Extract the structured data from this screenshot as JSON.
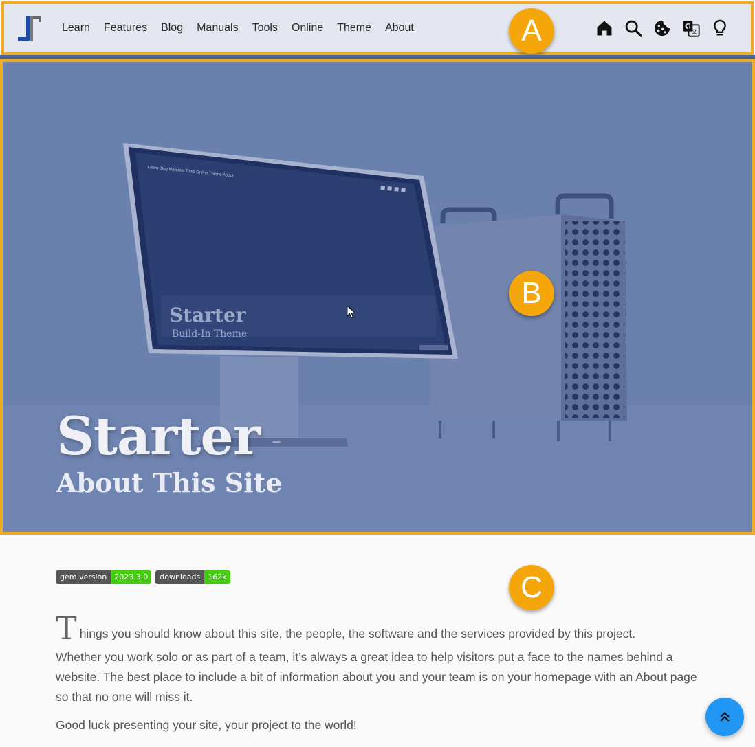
{
  "nav": {
    "items": [
      {
        "label": "Learn"
      },
      {
        "label": "Features"
      },
      {
        "label": "Blog"
      },
      {
        "label": "Manuals"
      },
      {
        "label": "Tools"
      },
      {
        "label": "Online"
      },
      {
        "label": "Theme"
      },
      {
        "label": "About"
      }
    ],
    "icons": [
      "home-icon",
      "search-icon",
      "cookie-icon",
      "translate-icon",
      "lightbulb-icon"
    ]
  },
  "hero": {
    "title": "Starter",
    "subtitle": "About This Site",
    "screen_title": "Starter",
    "screen_subtitle": "Build-In Theme",
    "screen_nav": [
      "Learn",
      "Blog",
      "Manuals",
      "Tools",
      "Online",
      "Theme",
      "About"
    ]
  },
  "markers": {
    "a": "A",
    "b": "B",
    "c": "C"
  },
  "badges": [
    {
      "label": "gem version",
      "value": "2023.3.0"
    },
    {
      "label": "downloads",
      "value": "162k"
    }
  ],
  "content": {
    "dropcap": "T",
    "intro": "hings you should know about this site, the people, the software and the services provided by this project.",
    "paragraph2": "Whether you work solo or as part of a team, it’s always a great idea to help visitors put a face to the names behind a website. The best place to include a bit of information about you and your team is on your homepage with an About page so that no one will miss it.",
    "paragraph3": "Good luck presenting your site, your project to the world!"
  },
  "colors": {
    "accent_border": "#f1ab1e",
    "marker": "#f4a60b",
    "hero_overlay": "#6a80ad",
    "back_to_top": "#2196f3",
    "badge_value": "#44cc11"
  }
}
